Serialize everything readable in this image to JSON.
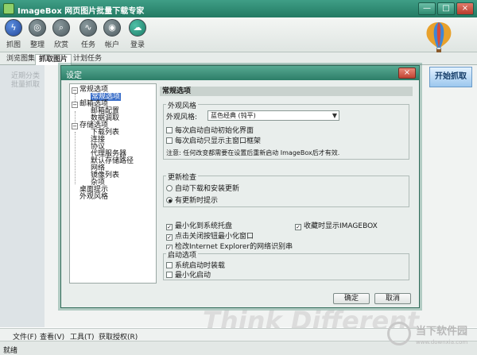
{
  "app": {
    "title": "ImageBox 网页图片批量下载专家"
  },
  "window_buttons": {
    "minimize": "—",
    "maximize": "□",
    "close": "×"
  },
  "toolbar": {
    "items": [
      {
        "label": "抓图",
        "icon": "lightning-icon",
        "glyph": "ϟ"
      },
      {
        "label": "整理",
        "icon": "disc-icon",
        "glyph": "◎"
      },
      {
        "label": "欣赏",
        "icon": "magnifier-icon",
        "glyph": "⌕"
      },
      {
        "label": "任务",
        "icon": "wave-icon",
        "glyph": "∿"
      },
      {
        "label": "帐户",
        "icon": "user-icon",
        "glyph": "◉"
      },
      {
        "label": "登录",
        "icon": "cloud-upload-icon",
        "glyph": "☁"
      }
    ]
  },
  "tabs": [
    "浏览图集",
    "抓取图片",
    "计划任务"
  ],
  "sidebar_faded": [
    "近期分类",
    "批量抓取"
  ],
  "start_button": "开始抓取",
  "watermark_text": "Think Different",
  "bottom_menu": [
    "文件(F)",
    "查看(V)",
    "工具(T)",
    "获取授权(R)"
  ],
  "status": "就绪",
  "site_watermark": {
    "name": "当下软件园",
    "url": "www.downxia.com"
  },
  "dialog": {
    "title": "设定",
    "close": "×",
    "tree": [
      {
        "label": "常规选项",
        "expander": "−"
      },
      {
        "label": "常规选项",
        "selected": true
      },
      {
        "label": "邮箱选项",
        "expander": "−"
      },
      {
        "label": "邮箱配置"
      },
      {
        "label": "数据调取"
      },
      {
        "label": "存储选项",
        "expander": "−"
      },
      {
        "label": "下载列表"
      },
      {
        "label": "连接"
      },
      {
        "label": "协议"
      },
      {
        "label": "代理服务器"
      },
      {
        "label": "默认存储路径"
      },
      {
        "label": "网络"
      },
      {
        "label": "镜像列表"
      },
      {
        "label": "杂项"
      },
      {
        "label": "桌面提示"
      },
      {
        "label": "外观风格"
      }
    ],
    "panel_title": "常规选项",
    "appearance": {
      "group": "外观风格",
      "label": "外观风格:",
      "value": "蓝色经典 (钝平)",
      "options": [
        {
          "label": "每次启动自动初始化界面",
          "checked": false
        },
        {
          "label": "每次启动只显示主窗口框架",
          "checked": false
        }
      ],
      "note": "注意: 任何改变都需要在设置后重新启动 ImageBox后才有效."
    },
    "update": {
      "group": "更新检查",
      "options": [
        {
          "label": "自动下载和安装更新",
          "selected": false
        },
        {
          "label": "有更新时提示",
          "selected": true
        }
      ]
    },
    "checks": [
      {
        "label": "最小化到系统托盘",
        "checked": true
      },
      {
        "label": "点击关闭按钮最小化窗口",
        "checked": true
      },
      {
        "label": "检改Internet Explorer的网络识别串",
        "checked": true
      },
      {
        "label": "收藏时显示IMAGEBOX",
        "checked": true
      }
    ],
    "startup": {
      "group": "启动选项",
      "options": [
        {
          "label": "系统启动时装载",
          "checked": false
        },
        {
          "label": "最小化启动",
          "checked": false
        }
      ]
    },
    "ok": "确定",
    "cancel": "取消"
  }
}
